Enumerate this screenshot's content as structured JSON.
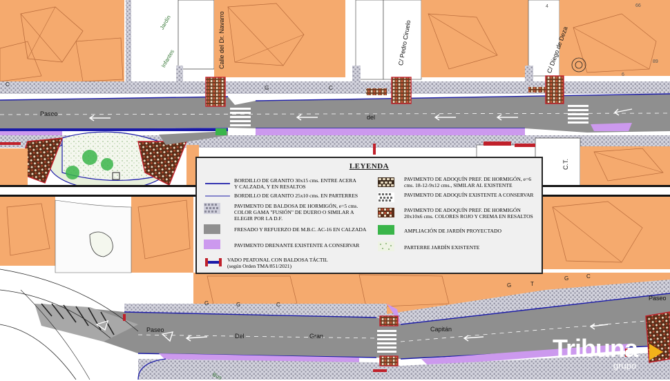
{
  "streets": {
    "paseo_top": "Paseo",
    "del_top": "del",
    "jardin": "Jardín",
    "infantes": "Infantes",
    "calle_navarro": "Calle del Dr. Navarro",
    "pedro_ciruelo": "C/ Pedro Ciruelo",
    "diego_deza": "C/ Diego de Deza",
    "ct": "C.T.",
    "paseo_bottom_right": "Paseo",
    "paseo_bottom_left": "Paseo",
    "del_bottom": "Del",
    "gran_bottom": "Gran",
    "capitan": "Capitán",
    "bus": "Bus"
  },
  "map_codes": {
    "c": "C",
    "g": "G",
    "t": "T",
    "n1": "4",
    "n2": "66",
    "n3": "89",
    "n4": "6"
  },
  "legend": {
    "title": "LEYENDA",
    "left": [
      {
        "kind": "line-blue",
        "text": "BORDILLO DE GRANITO 30x15 cms. ENTRE ACERA Y CALZADA, Y EN RESALTOS"
      },
      {
        "kind": "line-blue-thin",
        "text": "BORDILLO DE GRANITO 25x10 cms. EN PARTERRES"
      },
      {
        "kind": "tile",
        "text": "PAVIMENTO DE BALDOSA DE HORMIGÓN, e=5 cms. COLOR GAMA \"FUSIÓN\" DE DUERO O SIMILAR A ELEGIR POR LA D.F."
      },
      {
        "kind": "grey",
        "text": "FRESADO Y REFUERZO DE M.B.C. AC-16 EN CALZADA"
      },
      {
        "kind": "purple",
        "text": "PAVIMENTO DRENANTE EXISTENTE A CONSERVAR"
      },
      {
        "kind": "vado",
        "text": "VADO PEATONAL CON BALDOSA TÁCTIL (según Orden TMA/851/2021)"
      }
    ],
    "right": [
      {
        "kind": "adoquin-new",
        "text": "PAVIMENTO DE ADOQUÍN PREF. DE HORMIGÓN, e=6 cms. 18-12-9x12 cms., SIMILAR AL EXISTENTE"
      },
      {
        "kind": "adoquin-exist",
        "text": "PAVIMENTO DE ADOQUÍN EXISTENTE A CONSERVAR"
      },
      {
        "kind": "adoquin-red",
        "text": "PAVIMENTO DE ADOQUÍN PREF. DE HORMIGÓN 20x10x6 cms. COLORES ROJO Y CREMA EN RESALTOS"
      },
      {
        "kind": "green",
        "text": "AMPLIACIÓN DE JARDÍN PROYECTADO"
      },
      {
        "kind": "parterre",
        "text": "PARTERRE JARDÍN EXISTENTE"
      }
    ]
  },
  "watermark": {
    "brand": "Tribuna",
    "sub": "grupo"
  },
  "colors": {
    "building": "#f5aa6e",
    "road": "#8f8f8f",
    "sidewalk": "#c9c9d4",
    "curb": "#1a1aa8",
    "purple": "#cc99ee",
    "green": "#3ab54a",
    "red": "#c0202a"
  }
}
